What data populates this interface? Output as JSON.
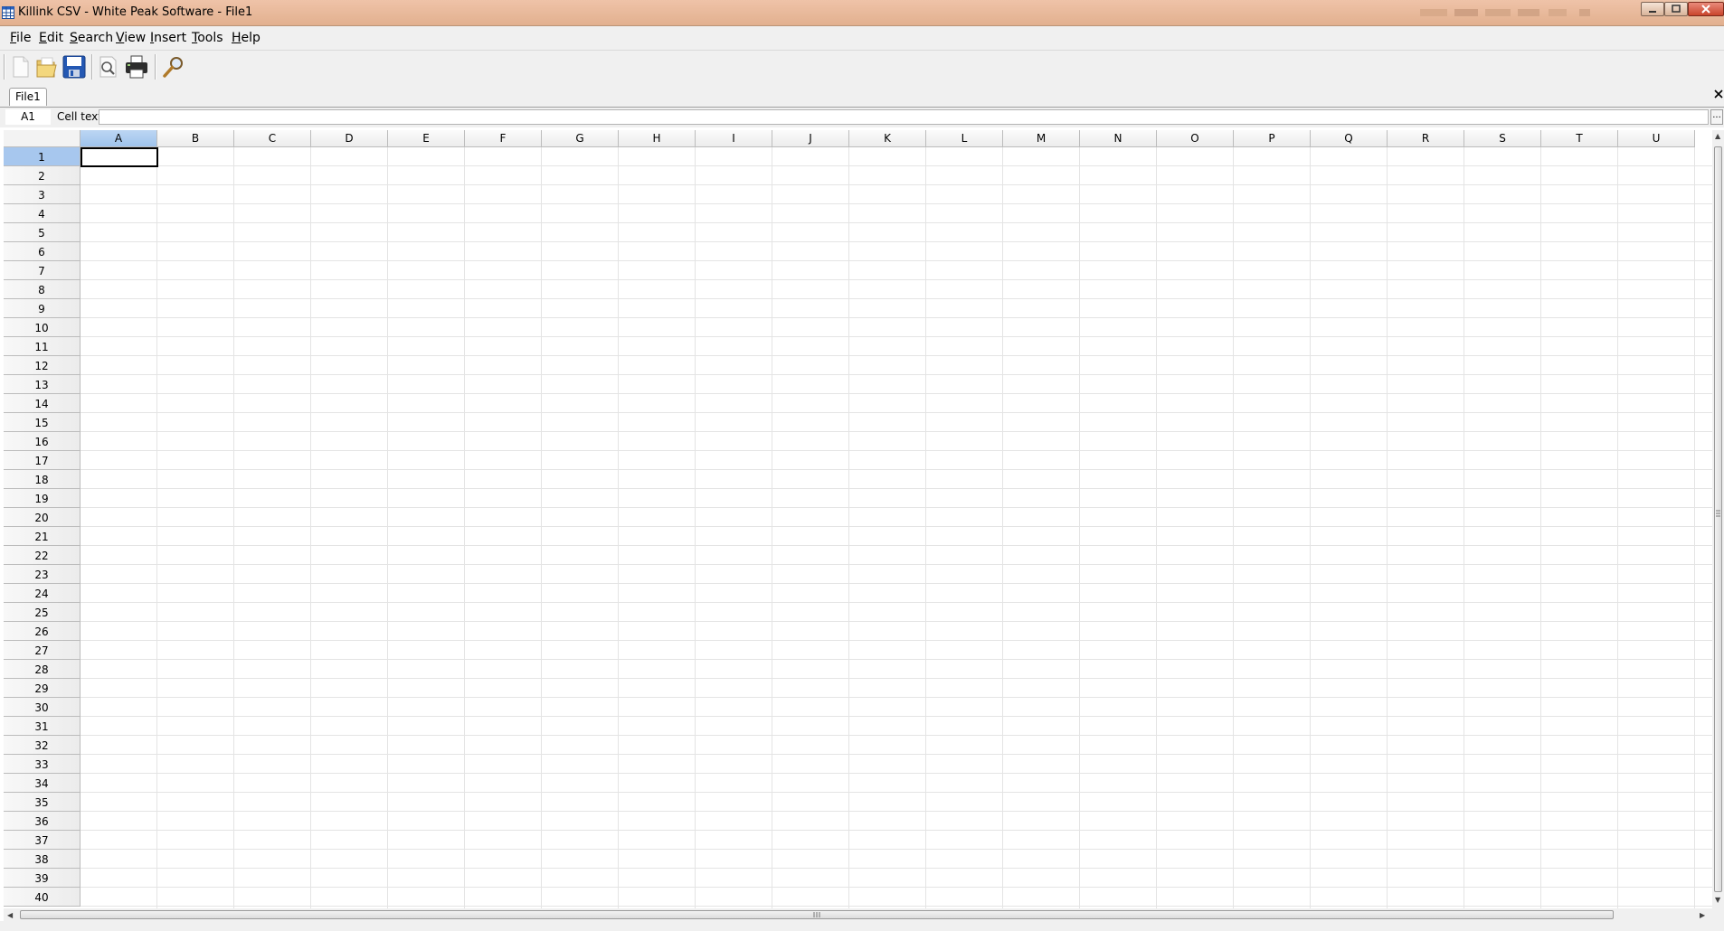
{
  "window": {
    "title": "Killink CSV - White Peak Software - File1",
    "icon": "spreadsheet-grid-icon",
    "controls": [
      "minimize-icon",
      "maximize-icon",
      "close-icon"
    ]
  },
  "menu": {
    "file": {
      "hot": "F",
      "rest": "ile"
    },
    "edit": {
      "hot": "E",
      "rest": "dit"
    },
    "search": {
      "hot": "S",
      "rest": "earch"
    },
    "view": {
      "hot": "V",
      "rest": "iew"
    },
    "insert": {
      "hot": "I",
      "rest": "nsert"
    },
    "tools": {
      "hot": "T",
      "rest": "ools"
    },
    "help": {
      "hot": "H",
      "rest": "elp"
    }
  },
  "toolbar": {
    "buttons": [
      "new-file-icon",
      "open-folder-icon",
      "save-icon",
      "print-preview-icon",
      "print-icon",
      "find-icon"
    ]
  },
  "tabs": [
    {
      "label": "File1",
      "active": true
    }
  ],
  "formula_bar": {
    "cell_ref": "A1",
    "cell_text_label": "Cell text:",
    "cell_text_value": "",
    "ellipsis": "..."
  },
  "grid": {
    "columns": [
      "A",
      "B",
      "C",
      "D",
      "E",
      "F",
      "G",
      "H",
      "I",
      "J",
      "K",
      "L",
      "M",
      "N",
      "O",
      "P",
      "Q",
      "R",
      "S",
      "T",
      "U"
    ],
    "rows": [
      "1",
      "2",
      "3",
      "4",
      "5",
      "6",
      "7",
      "8",
      "9",
      "10",
      "11",
      "12",
      "13",
      "14",
      "15",
      "16",
      "17",
      "18",
      "19",
      "20",
      "21",
      "22",
      "23",
      "24",
      "25",
      "26",
      "27",
      "28",
      "29",
      "30",
      "31",
      "32",
      "33",
      "34",
      "35",
      "36",
      "37",
      "38",
      "39",
      "40"
    ],
    "selected_column": "A",
    "selected_row": "1"
  },
  "colors": {
    "titlebar": "#e2b08f",
    "selected_header": "#a7c7ee",
    "gridline": "#e4e4e4"
  }
}
